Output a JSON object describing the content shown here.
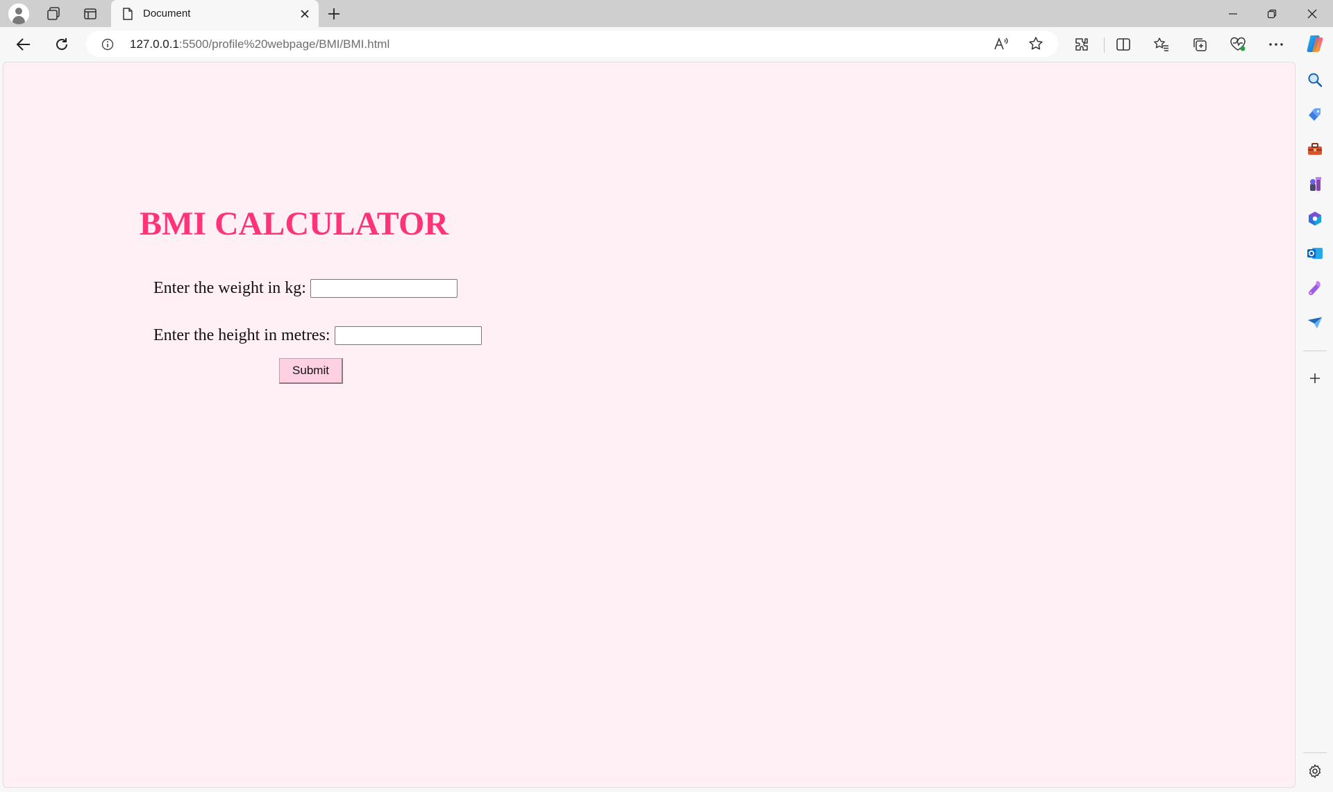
{
  "browser": {
    "tab": {
      "title": "Document"
    },
    "address": {
      "host": "127.0.0.1",
      "rest": ":5500/profile%20webpage/BMI/BMI.html"
    }
  },
  "page": {
    "heading": "BMI CALCULATOR",
    "weight_label": "Enter the weight in kg:",
    "weight_value": "",
    "height_label": "Enter the height in metres:",
    "height_value": "",
    "submit_label": "Submit"
  },
  "colors": {
    "page_background": "#fff0f5",
    "heading": "#ff3377",
    "button": "#ffd0e2",
    "browser_chrome": "#cfcfcf"
  },
  "icons": {
    "titlebar": [
      "profile-icon",
      "workspaces-icon",
      "tab-actions-icon",
      "page-icon",
      "close-icon",
      "new-tab-icon",
      "minimize-icon",
      "restore-icon",
      "window-close-icon"
    ],
    "toolbar": [
      "back-arrow-icon",
      "refresh-icon",
      "info-icon",
      "read-aloud-icon",
      "favorite-star-icon",
      "extensions-icon",
      "split-screen-icon",
      "favorites-icon",
      "collections-icon",
      "browser-essentials-icon",
      "more-icon",
      "copilot-icon"
    ],
    "sidebar": [
      "search-icon",
      "shopping-icon",
      "tools-icon",
      "games-icon",
      "microsoft-365-icon",
      "outlook-icon",
      "designer-icon",
      "drop-icon",
      "add-icon",
      "settings-icon"
    ]
  }
}
